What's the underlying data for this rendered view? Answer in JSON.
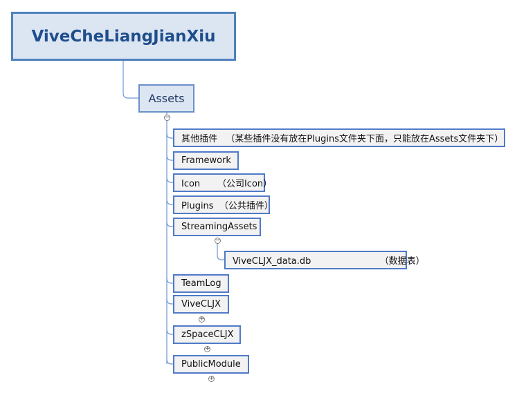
{
  "root": {
    "label": "ViveCheLiangJianXiu"
  },
  "assets": {
    "label": "Assets",
    "toggle": "−"
  },
  "children": [
    {
      "label": "其他插件   （某些插件没有放在Plugins文件夹下面，只能放在Assets文件夹下）"
    },
    {
      "label": "Framework"
    },
    {
      "label": "Icon      （公司Icon）"
    },
    {
      "label": "Plugins  （公共插件）"
    },
    {
      "label": "StreamingAssets",
      "toggle": "−"
    },
    {
      "label": "TeamLog"
    },
    {
      "label": "ViveCLJX",
      "toggle": "+"
    },
    {
      "label": "zSpaceCLJX",
      "toggle": "+"
    },
    {
      "label": "PublicModule",
      "toggle": "+"
    }
  ],
  "streaming_child": {
    "label": "ViveCLJX_data.db                        （数据表）"
  },
  "colors": {
    "line": "#6d95d2",
    "border": "#4f7ac7",
    "root_fill": "#dce6f2",
    "leaf_fill": "#f2f2f2"
  }
}
